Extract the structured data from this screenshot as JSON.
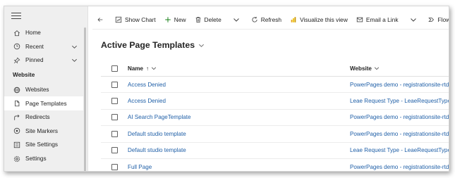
{
  "sidebar": {
    "items": [
      {
        "label": "Home",
        "icon": "home-icon"
      },
      {
        "label": "Recent",
        "icon": "clock-icon",
        "expandable": true
      },
      {
        "label": "Pinned",
        "icon": "pin-icon",
        "expandable": true
      }
    ],
    "section_title": "Website",
    "section_items": [
      {
        "label": "Websites",
        "icon": "globe-icon"
      },
      {
        "label": "Page Templates",
        "icon": "document-icon",
        "selected": true
      },
      {
        "label": "Redirects",
        "icon": "redirect-icon"
      },
      {
        "label": "Site Markers",
        "icon": "marker-icon"
      },
      {
        "label": "Site Settings",
        "icon": "site-settings-icon"
      },
      {
        "label": "Settings",
        "icon": "gear-icon"
      }
    ]
  },
  "toolbar": {
    "show_chart": "Show Chart",
    "new": "New",
    "delete": "Delete",
    "refresh": "Refresh",
    "visualize": "Visualize this view",
    "email_link": "Email a Link",
    "flow": "Flow"
  },
  "view": {
    "title": "Active Page Templates"
  },
  "grid": {
    "columns": {
      "name": "Name",
      "name_sort": "↑",
      "website": "Website"
    },
    "rows": [
      {
        "name": "Access Denied",
        "website": "PowerPages demo - registrationsite-rtd..."
      },
      {
        "name": "Access Denied",
        "website": "Leae Request Type - LeaeRequestType"
      },
      {
        "name": "AI Search PageTemplate",
        "website": "PowerPages demo - registrationsite-rtd..."
      },
      {
        "name": "Default studio template",
        "website": "PowerPages demo - registrationsite-rtd..."
      },
      {
        "name": "Default studio template",
        "website": "Leae Request Type - LeaeRequestType"
      },
      {
        "name": "Full Page",
        "website": "PowerPages demo - registrationsite-rtd..."
      }
    ]
  },
  "colors": {
    "link": "#1f5fa7",
    "visualize_icon": "#e8a317",
    "new_icon": "#107c10"
  }
}
